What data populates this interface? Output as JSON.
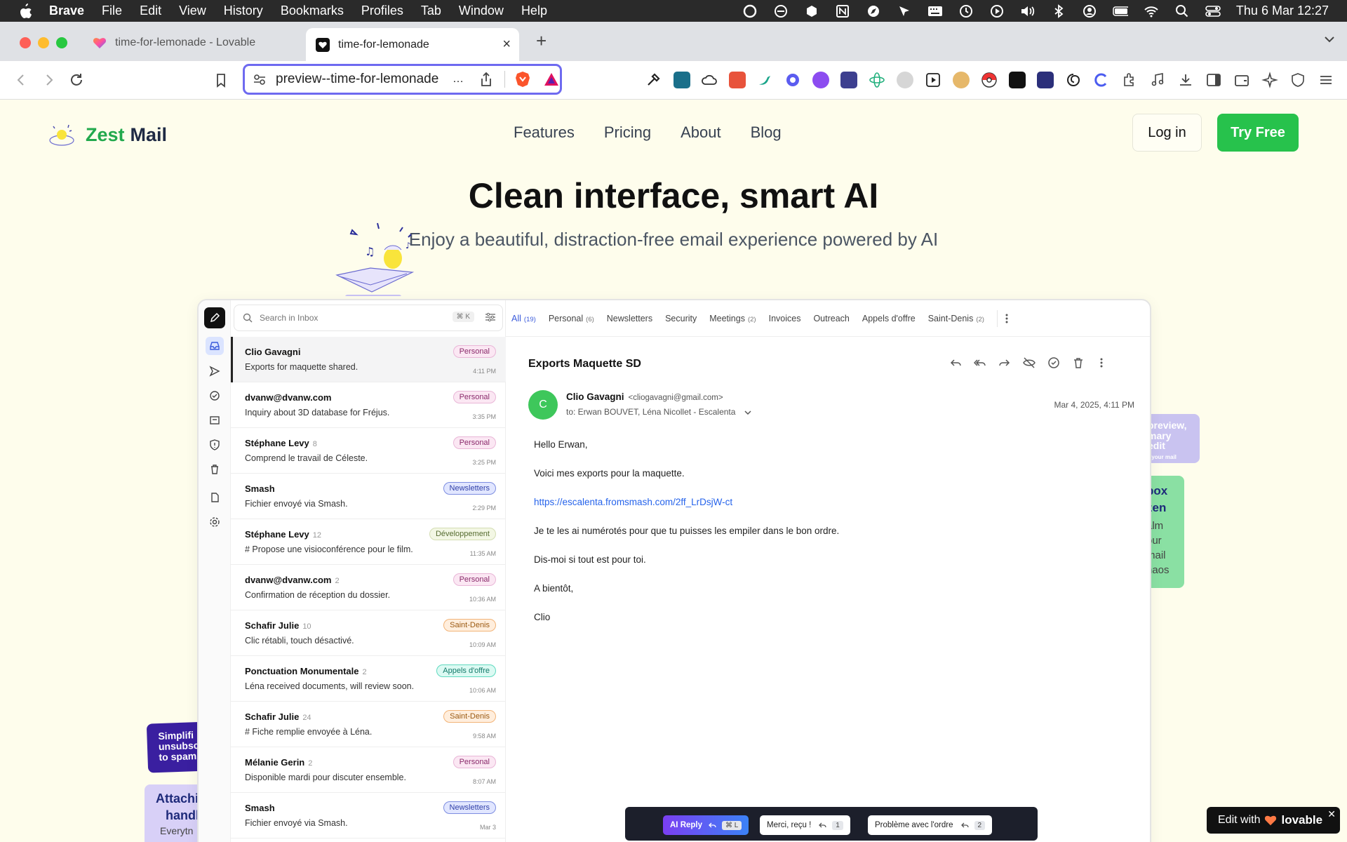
{
  "menubar": {
    "app": "Brave",
    "items": [
      "File",
      "Edit",
      "View",
      "History",
      "Bookmarks",
      "Profiles",
      "Tab",
      "Window",
      "Help"
    ],
    "clock": "Thu 6 Mar  12:27"
  },
  "browser": {
    "tabs": [
      {
        "title": "time-for-lemonade - Lovable"
      },
      {
        "title": "time-for-lemonade"
      }
    ],
    "url": "preview--time-for-lemonade"
  },
  "site": {
    "brand_part1": "Zest",
    "brand_part2": "Mail",
    "nav": [
      "Features",
      "Pricing",
      "About",
      "Blog"
    ],
    "login_label": "Log in",
    "try_label": "Try Free",
    "hero_title": "Clean interface, smart AI",
    "hero_subtitle": "Enjoy a beautiful, distraction-free email experience powered by AI",
    "card_right_top": [
      "preview,",
      "mary",
      "edit",
      "r your mail"
    ],
    "card_right_green": [
      "box",
      "zen",
      "alm",
      "our",
      "mail",
      "haos"
    ],
    "card_left_purple": [
      "Simplifi",
      "unsubsc",
      "to spam"
    ],
    "card_left_lavender": [
      "Attachi",
      "handl",
      "Everytn"
    ]
  },
  "app": {
    "search_placeholder": "Search in Inbox",
    "search_shortcut": "⌘ K",
    "filters": [
      {
        "label": "All",
        "count": "(19)"
      },
      {
        "label": "Personal",
        "count": "(6)"
      },
      {
        "label": "Newsletters",
        "count": ""
      },
      {
        "label": "Security",
        "count": ""
      },
      {
        "label": "Meetings",
        "count": "(2)"
      },
      {
        "label": "Invoices",
        "count": ""
      },
      {
        "label": "Outreach",
        "count": ""
      },
      {
        "label": "Appels d'offre",
        "count": ""
      },
      {
        "label": "Saint-Denis",
        "count": "(2)"
      }
    ],
    "mails": [
      {
        "sender": "Clio Gavagni",
        "count": "",
        "subject": "Exports for maquette shared.",
        "tag": "Personal",
        "time": "4:11 PM"
      },
      {
        "sender": "dvanw@dvanw.com",
        "count": "",
        "subject": "Inquiry about 3D database for Fréjus.",
        "tag": "Personal",
        "time": "3:35 PM"
      },
      {
        "sender": "Stéphane Levy",
        "count": "8",
        "subject": "Comprend le travail de Céleste.",
        "tag": "Personal",
        "time": "3:25 PM"
      },
      {
        "sender": "Smash",
        "count": "",
        "subject": "Fichier envoyé via Smash.",
        "tag": "Newsletters",
        "time": "2:29 PM"
      },
      {
        "sender": "Stéphane Levy",
        "count": "12",
        "subject": "# Propose une visioconférence pour le film.",
        "tag": "Développement",
        "time": "11:35 AM"
      },
      {
        "sender": "dvanw@dvanw.com",
        "count": "2",
        "subject": "Confirmation de réception du dossier.",
        "tag": "Personal",
        "time": "10:36 AM"
      },
      {
        "sender": "Schafir Julie",
        "count": "10",
        "subject": "Clic rétabli, touch désactivé.",
        "tag": "Saint-Denis",
        "time": "10:09 AM"
      },
      {
        "sender": "Ponctuation Monumentale",
        "count": "2",
        "subject": "Léna received documents, will review soon.",
        "tag": "Appels d'offre",
        "time": "10:06 AM"
      },
      {
        "sender": "Schafir Julie",
        "count": "24",
        "subject": "# Fiche remplie envoyée à Léna.",
        "tag": "Saint-Denis",
        "time": "9:58 AM"
      },
      {
        "sender": "Mélanie Gerin",
        "count": "2",
        "subject": "Disponible mardi pour discuter ensemble.",
        "tag": "Personal",
        "time": "8:07 AM"
      },
      {
        "sender": "Smash",
        "count": "",
        "subject": "Fichier envoyé via Smash.",
        "tag": "Newsletters",
        "time": "Mar 3"
      }
    ],
    "reader": {
      "subject": "Exports Maquette SD",
      "avatar_letter": "C",
      "from_name": "Clio Gavagni",
      "from_email": "<cliogavagni@gmail.com>",
      "to": "to: Erwan BOUVET, Léna Nicollet - Escalenta",
      "date": "Mar 4, 2025, 4:11 PM",
      "body": [
        "Hello Erwan,",
        "Voici mes exports pour la maquette.",
        "https://escalenta.fromsmash.com/2ff_LrDsjW-ct",
        "Je te les ai numérotés pour que tu puisses les empiler dans le bon ordre.",
        "Dis-moi si tout est pour toi.",
        "A bientôt,",
        "Clio"
      ]
    },
    "ai_bar": {
      "ai_label": "AI Reply",
      "ai_kbd": "⌘ L",
      "reply1": "Merci, reçu !",
      "reply1_kbd": "1",
      "reply2": "Problème avec l'ordre",
      "reply2_kbd": "2"
    }
  },
  "badge": {
    "edit_with": "Edit with",
    "brand": "lovable"
  },
  "colors": {
    "accent_green": "#27c24c",
    "page_bg": "#fefdec",
    "url_focus": "#6e6af0"
  }
}
